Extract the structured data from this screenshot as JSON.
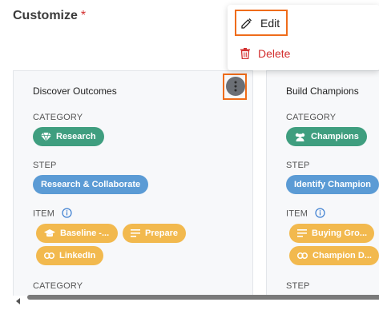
{
  "page": {
    "title": "Customize",
    "required_mark": "*"
  },
  "menu": {
    "edit_label": "Edit",
    "delete_label": "Delete"
  },
  "cards": [
    {
      "title": "Discover Outcomes",
      "category_label": "CATEGORY",
      "category": "Research",
      "step_label": "STEP",
      "step": "Research & Collaborate",
      "item_label": "ITEM",
      "items": [
        "Baseline -...",
        "Prepare",
        "LinkedIn"
      ],
      "next_label": "CATEGORY"
    },
    {
      "title": "Build Champions",
      "category_label": "CATEGORY",
      "category": "Champions",
      "step_label": "STEP",
      "step": "Identify Champion",
      "item_label": "ITEM",
      "items": [
        "Buying Gro...",
        "Champion D..."
      ],
      "next_label": "STEP"
    }
  ],
  "colors": {
    "category_chip": "#3f9e7f",
    "step_chip": "#5b9bd5",
    "item_chip": "#f2b94e",
    "highlight": "#ef6c1a",
    "delete": "#d32f2f"
  }
}
